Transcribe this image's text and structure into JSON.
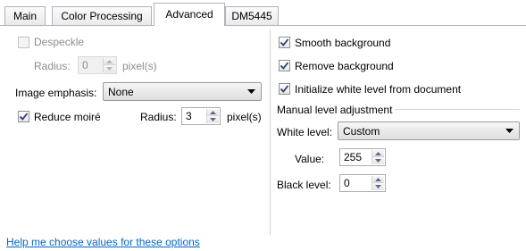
{
  "tabs": [
    {
      "label": "Main"
    },
    {
      "label": "Color Processing"
    },
    {
      "label": "Advanced"
    },
    {
      "label": "DM5445"
    }
  ],
  "left": {
    "despeckle": {
      "label": "Despeckle",
      "checked": false
    },
    "despeckle_radius": {
      "label": "Radius:",
      "value": "0",
      "unit": "pixel(s)"
    },
    "image_emphasis": {
      "label": "Image emphasis:",
      "value": "None"
    },
    "reduce_moire": {
      "label": "Reduce moiré",
      "checked": true
    },
    "moire_radius": {
      "label": "Radius:",
      "value": "3",
      "unit": "pixel(s)"
    }
  },
  "right": {
    "smooth_background": {
      "label": "Smooth background",
      "checked": true
    },
    "remove_background": {
      "label": "Remove background",
      "checked": true
    },
    "initialize_white": {
      "label": "Initialize white level from document",
      "checked": true
    },
    "group_label": "Manual level adjustment",
    "white_level": {
      "label": "White level:",
      "value": "Custom"
    },
    "value": {
      "label": "Value:",
      "value": "255"
    },
    "black_level": {
      "label": "Black level:",
      "value": "0"
    }
  },
  "help_link": "Help me choose values for these options",
  "colors": {
    "link": "#0066cc",
    "disabled_text": "#8d8d8d"
  }
}
